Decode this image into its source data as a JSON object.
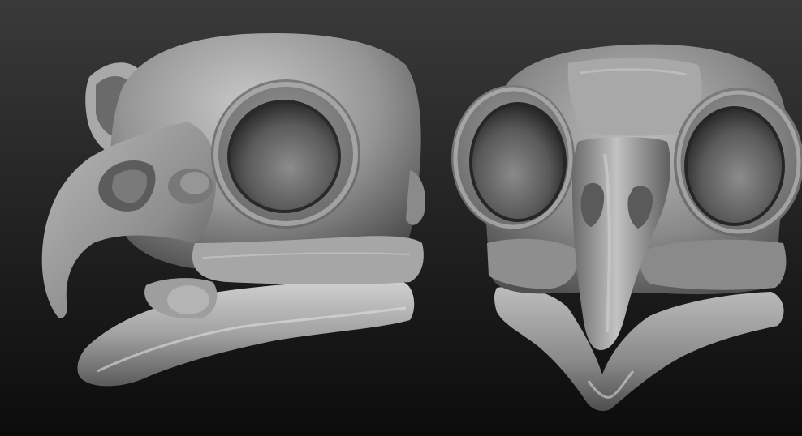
{
  "scene": {
    "background_top": "#3a3a3a",
    "background_bottom": "#0c0c0c",
    "material_light": "#c4c4c4",
    "material_mid": "#8e8e8e",
    "material_dark": "#3e3e3e",
    "models": [
      {
        "name": "owl-skull-three-quarter-view"
      },
      {
        "name": "owl-skull-front-view"
      }
    ]
  }
}
